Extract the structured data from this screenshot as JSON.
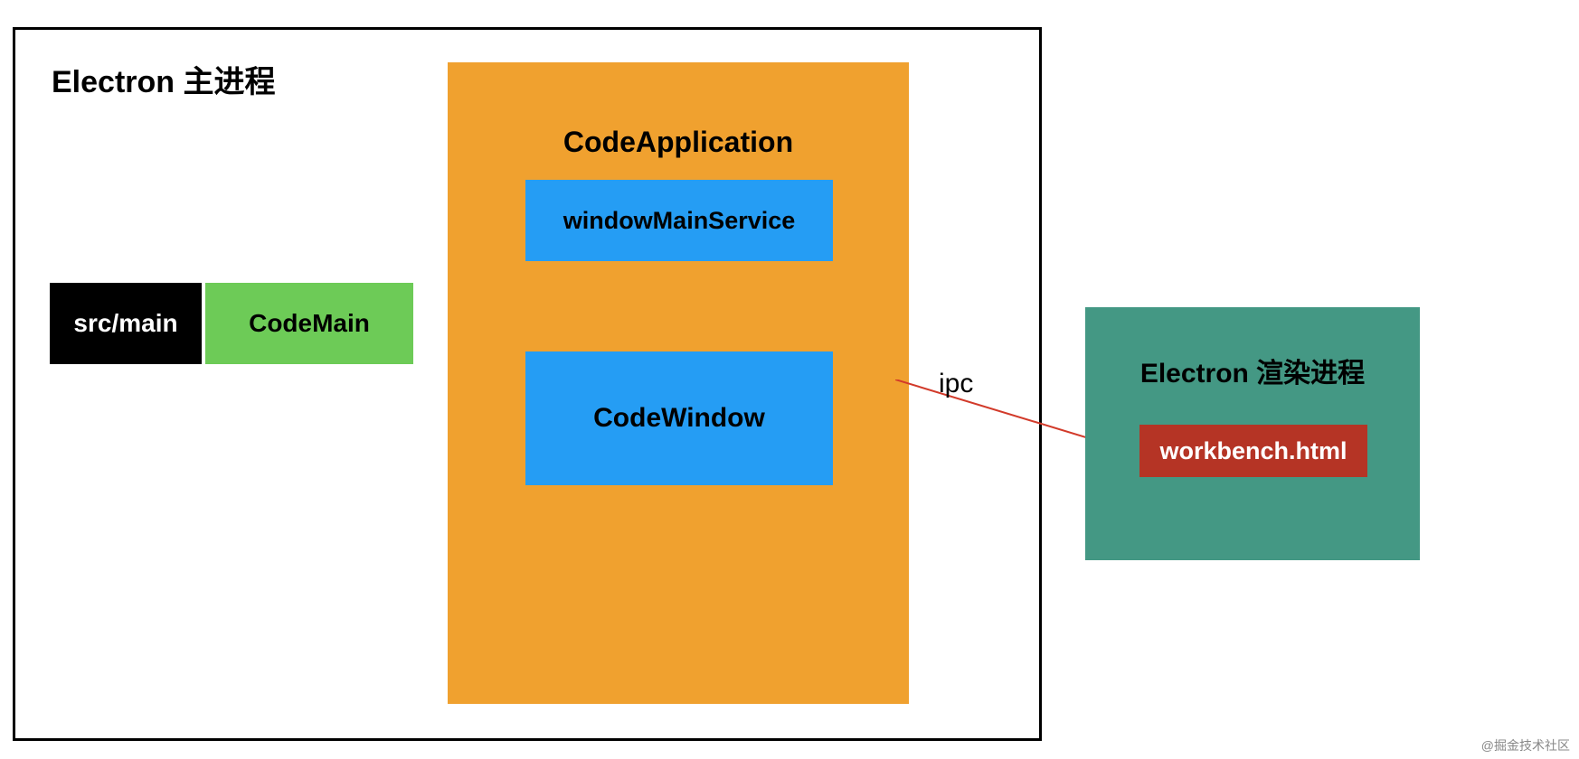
{
  "main_process": {
    "title": "Electron 主进程",
    "src_main": "src/main",
    "code_main": "CodeMain",
    "code_application": {
      "title": "CodeApplication",
      "window_main_service": "windowMainService",
      "code_window": "CodeWindow"
    }
  },
  "ipc_label": "ipc",
  "render_process": {
    "title": "Electron 渲染进程",
    "workbench": "workbench.html"
  },
  "watermark": "@掘金技术社区",
  "colors": {
    "black": "#000000",
    "green": "#6dcb57",
    "orange": "#f0a12f",
    "blue": "#259df4",
    "teal": "#449884",
    "red": "#b53425",
    "ipc_line": "#d23a2a"
  }
}
